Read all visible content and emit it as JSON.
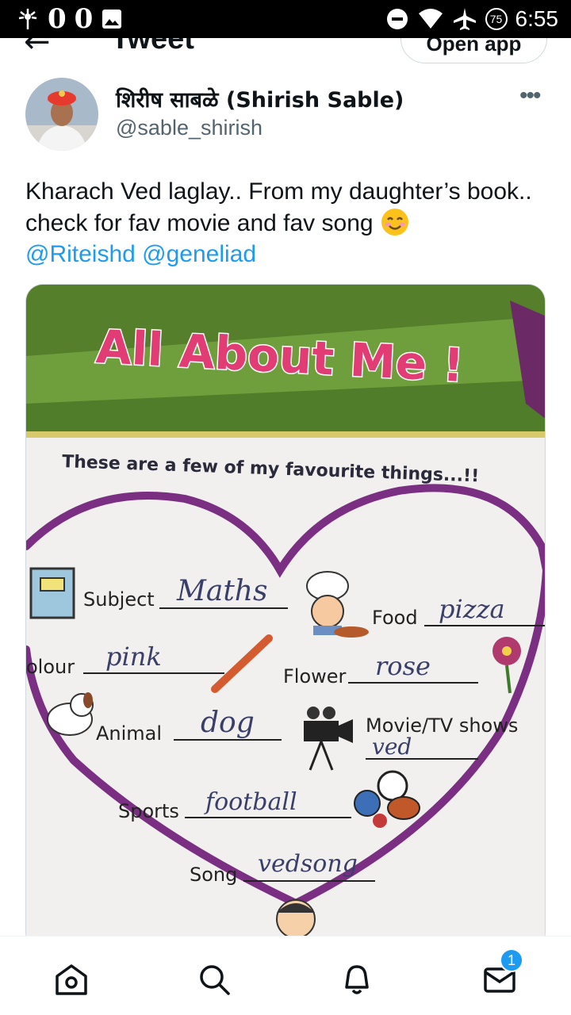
{
  "status_bar": {
    "left_glyphs": [
      "0",
      "0"
    ],
    "time": "6:55",
    "battery": "75",
    "icons": [
      "sparkle-icon",
      "image-icon",
      "do-not-disturb-icon",
      "wifi-icon",
      "airplane-icon",
      "battery-icon"
    ]
  },
  "header": {
    "title": "Tweet",
    "open_app_label": "Open app"
  },
  "tweet": {
    "author_name": "शिरीष साबळे (Shirish Sable)",
    "author_handle": "@sable_shirish",
    "more_label": "•••",
    "text": "Kharach Ved laglay.. From my daughter’s book.. check for fav movie and fav song",
    "mentions": "@Riteishd @geneliad"
  },
  "media": {
    "banner_title": "All About Me !",
    "subtitle": "These are a few of my favourite things...!!",
    "rows": [
      {
        "label": "Subject",
        "answer": "Maths"
      },
      {
        "label": "Food",
        "answer": "pizza"
      },
      {
        "label": "olour",
        "answer": "pink"
      },
      {
        "label": "Flower",
        "answer": "rose"
      },
      {
        "label": "Animal",
        "answer": "dog"
      },
      {
        "label": "Movie/TV shows",
        "answer": "ved"
      },
      {
        "label": "Sports",
        "answer": "football"
      },
      {
        "label": "Song",
        "answer": "vedsong"
      }
    ]
  },
  "bottom_nav": {
    "items": [
      "home-icon",
      "search-icon",
      "notifications-icon",
      "messages-icon"
    ],
    "messages_badge": "1"
  },
  "colors": {
    "accent": "#1d9bf0",
    "banner_green": "#6a9a3a",
    "heart_purple": "#7a2f82",
    "title_pink": "#e23c74"
  }
}
